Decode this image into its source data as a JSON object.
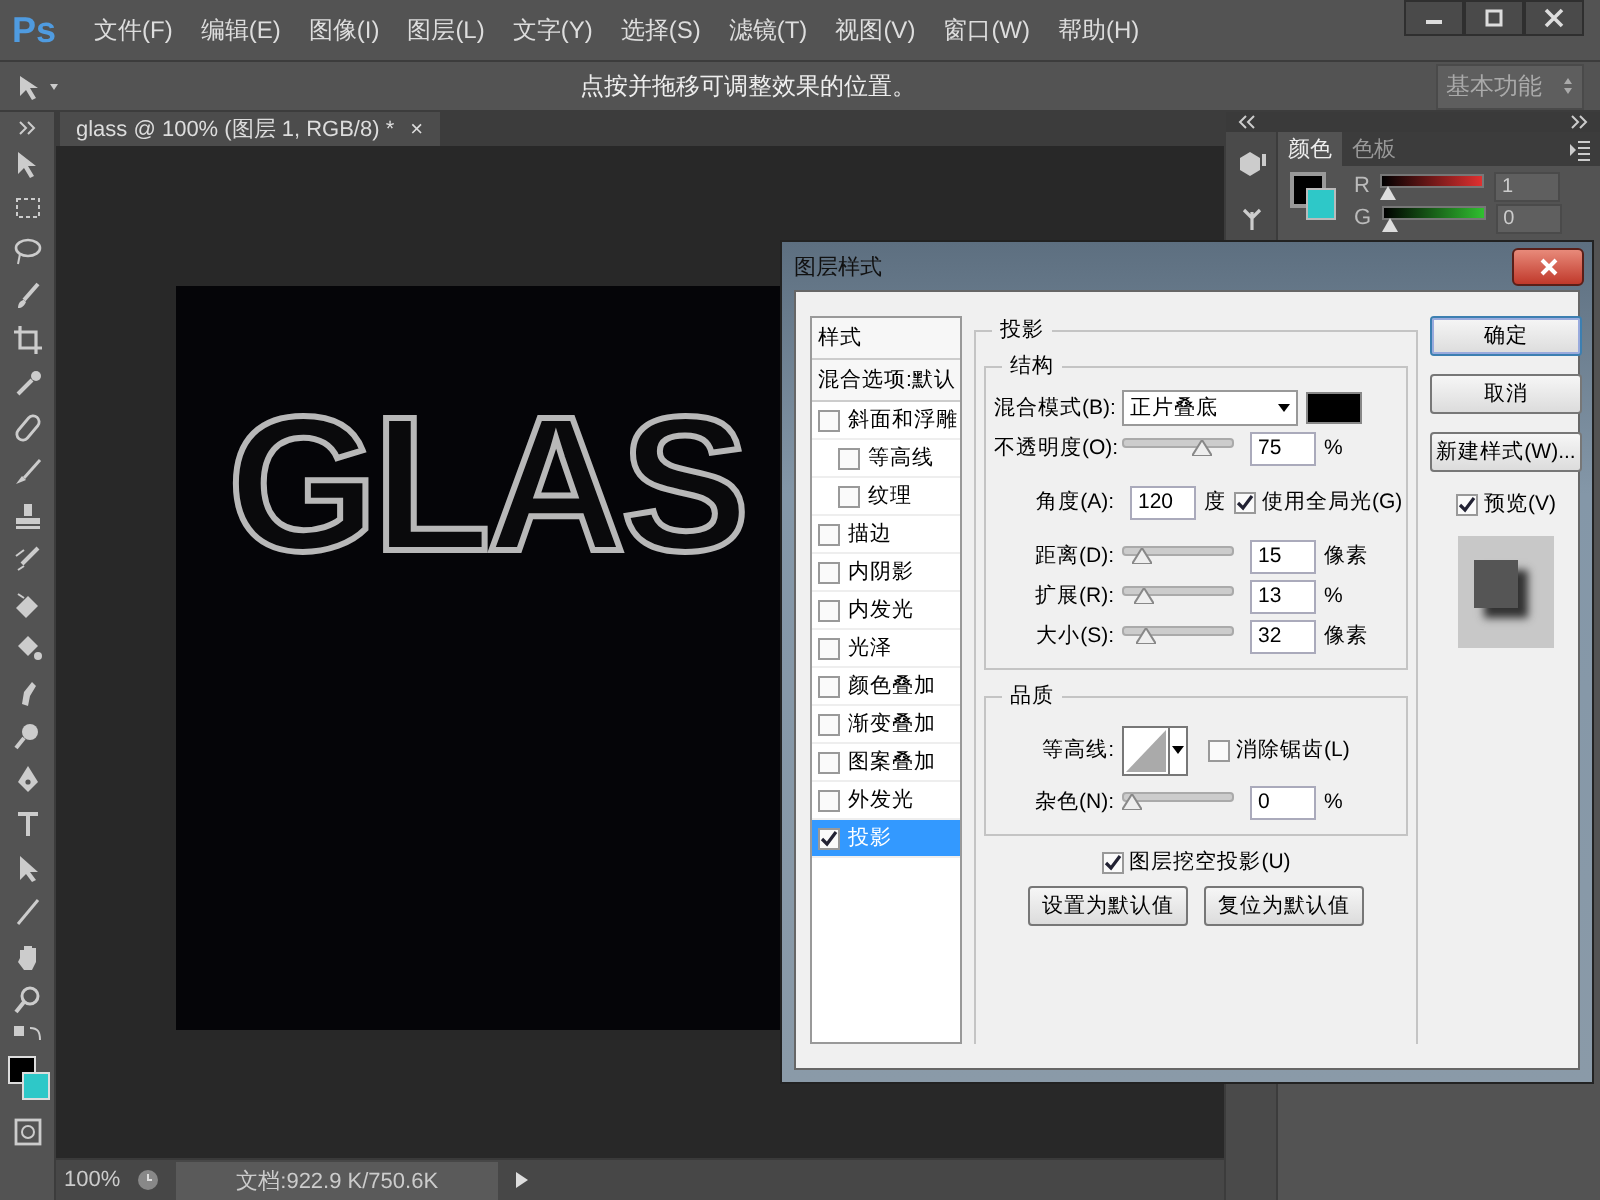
{
  "app": {
    "logo": "Ps",
    "menus": [
      "文件(F)",
      "编辑(E)",
      "图像(I)",
      "图层(L)",
      "文字(Y)",
      "选择(S)",
      "滤镜(T)",
      "视图(V)",
      "窗口(W)",
      "帮助(H)"
    ]
  },
  "options_bar": {
    "hint": "点按并拖移可调整效果的位置。",
    "workspace": "基本功能"
  },
  "document_tab": {
    "title": "glass @ 100% (图层 1, RGB/8) *",
    "close": "×"
  },
  "canvas": {
    "text": "GLAS"
  },
  "color_panel": {
    "tabs": [
      {
        "label": "颜色",
        "selected": true
      },
      {
        "label": "色板",
        "selected": false
      }
    ],
    "channels": [
      {
        "name": "R",
        "value": "1",
        "level": 0
      },
      {
        "name": "G",
        "value": "0",
        "level": 0
      }
    ]
  },
  "status_bar": {
    "zoom": "100%",
    "doc_info": "文档:922.9 K/750.6K"
  },
  "dialog": {
    "title": "图层样式",
    "styles_header": "样式",
    "blending_options": "混合选项:默认",
    "styles": [
      {
        "label": "斜面和浮雕",
        "checked": false,
        "selected": false,
        "children": [
          {
            "label": "等高线",
            "checked": false,
            "selected": false
          },
          {
            "label": "纹理",
            "checked": false,
            "selected": false
          }
        ]
      },
      {
        "label": "描边",
        "checked": false,
        "selected": false
      },
      {
        "label": "内阴影",
        "checked": false,
        "selected": false
      },
      {
        "label": "内发光",
        "checked": false,
        "selected": false
      },
      {
        "label": "光泽",
        "checked": false,
        "selected": false
      },
      {
        "label": "颜色叠加",
        "checked": false,
        "selected": false
      },
      {
        "label": "渐变叠加",
        "checked": false,
        "selected": false
      },
      {
        "label": "图案叠加",
        "checked": false,
        "selected": false
      },
      {
        "label": "外发光",
        "checked": false,
        "selected": false
      },
      {
        "label": "投影",
        "checked": true,
        "selected": true
      }
    ],
    "section_title": "投影",
    "structure": {
      "title": "结构",
      "blend_mode_label": "混合模式(B):",
      "blend_mode": "正片叠底",
      "opacity": {
        "label": "不透明度(O):",
        "level": 0.75,
        "value": "75",
        "unit": "%"
      },
      "angle": {
        "label": "角度(A):",
        "value": "120",
        "unit": "度",
        "global_light": {
          "label": "使用全局光(G)",
          "checked": true
        }
      },
      "sliders": [
        {
          "label": "距离(D):",
          "level": 0.1,
          "value": "15",
          "unit": "像素"
        },
        {
          "label": "扩展(R):",
          "level": 0.13,
          "value": "13",
          "unit": "%"
        },
        {
          "label": "大小(S):",
          "level": 0.15,
          "value": "32",
          "unit": "像素"
        }
      ]
    },
    "quality": {
      "title": "品质",
      "contour_label": "等高线:",
      "anti_alias": {
        "label": "消除锯齿(L)",
        "checked": false
      },
      "noise": {
        "label": "杂色(N):",
        "level": 0,
        "value": "0",
        "unit": "%"
      }
    },
    "knockout": {
      "label": "图层挖空投影(U)",
      "checked": true
    },
    "default_buttons": [
      "设置为默认值",
      "复位为默认值"
    ],
    "buttons": [
      "确定",
      "取消",
      "新建样式(W)..."
    ],
    "preview": {
      "label": "预览(V)",
      "checked": true
    }
  }
}
